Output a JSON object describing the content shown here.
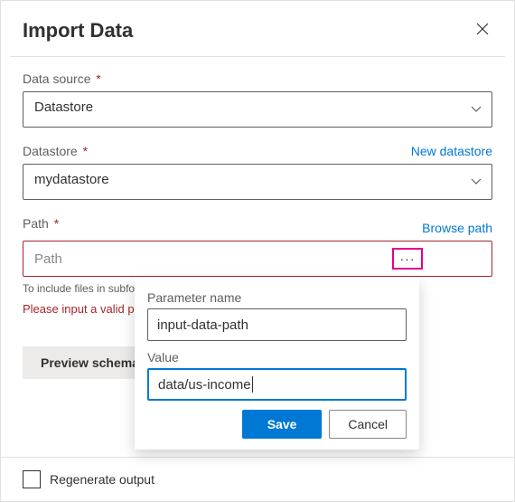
{
  "dialog": {
    "title": "Import Data"
  },
  "fields": {
    "data_source": {
      "label": "Data source",
      "value": "Datastore"
    },
    "datastore": {
      "label": "Datastore",
      "link": "New datastore",
      "value": "mydatastore"
    },
    "path": {
      "label": "Path",
      "browse_link": "Browse path",
      "more_icon": "···",
      "placeholder": "Path",
      "help": "To include files in subfolders, append '/**' after the folder name like '{folder}/**'.",
      "error": "Please input a valid path."
    }
  },
  "preview_button": "Preview schema",
  "footer": {
    "regenerate": "Regenerate output"
  },
  "popup": {
    "param_label": "Parameter name",
    "param_value": "input-data-path",
    "value_label": "Value",
    "value_value": "data/us-income",
    "save": "Save",
    "cancel": "Cancel"
  }
}
